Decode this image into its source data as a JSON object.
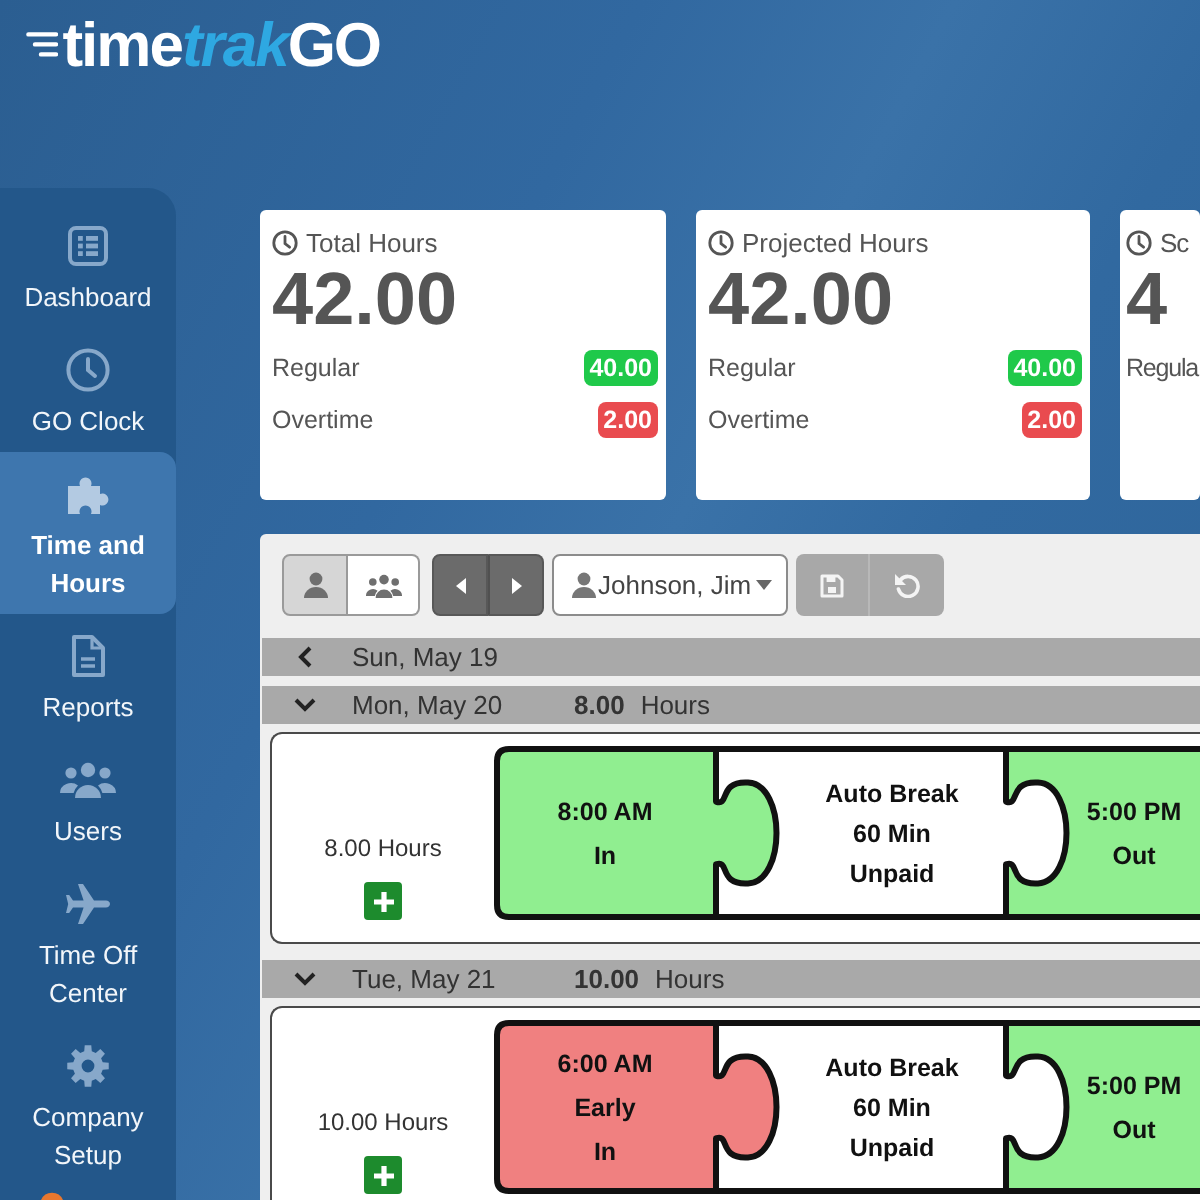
{
  "logo": [
    {
      "text": "time",
      "kind": "plain"
    },
    {
      "text": "trak",
      "kind": "accent"
    },
    {
      "text": "GO",
      "kind": "plain"
    }
  ],
  "sidebar": {
    "items": [
      {
        "label": "Dashboard",
        "selected": false
      },
      {
        "label": "GO Clock",
        "selected": false
      },
      {
        "label": "Time and Hours",
        "selected": true
      },
      {
        "label": "Reports",
        "selected": false
      },
      {
        "label": "Users",
        "selected": false
      },
      {
        "label": "Time Off Center",
        "selected": false
      },
      {
        "label": "Company Setup",
        "selected": false
      }
    ]
  },
  "summary_cards": [
    {
      "title": "Total Hours",
      "value": "42.00",
      "rows": [
        {
          "label": "Regular",
          "badge": "40.00",
          "color": "#1fc94a"
        },
        {
          "label": "Overtime",
          "badge": "2.00",
          "color": "#e94b4f"
        }
      ]
    },
    {
      "title": "Projected Hours",
      "value": "42.00",
      "rows": [
        {
          "label": "Regular",
          "badge": "40.00",
          "color": "#1fc94a"
        },
        {
          "label": "Overtime",
          "badge": "2.00",
          "color": "#e94b4f"
        }
      ]
    },
    {
      "title": "Sc",
      "value": "4",
      "rows": [
        {
          "label": "Regula"
        }
      ]
    }
  ],
  "toolbar": {
    "view_modes": [
      {
        "kind": "single",
        "selected": true
      },
      {
        "kind": "group",
        "selected": false
      }
    ],
    "employee_select": {
      "value": "Johnson, Jim"
    },
    "actions": [
      {
        "kind": "save",
        "disabled": true
      },
      {
        "kind": "undo",
        "disabled": true
      }
    ]
  },
  "days": [
    {
      "date": "Sun, May 19",
      "expanded": false
    },
    {
      "date": "Mon, May 20",
      "hours": "8.00",
      "unit": "Hours",
      "expanded": true,
      "total": "8.00 Hours",
      "punches": [
        {
          "kind": "punch",
          "lines": [
            "8:00 AM",
            "In"
          ],
          "color": "#90ee90"
        },
        {
          "kind": "break",
          "lines": [
            "Auto Break",
            "60 Min",
            "Unpaid"
          ],
          "color": "#ffffff"
        },
        {
          "kind": "punch",
          "lines": [
            "5:00 PM",
            "Out"
          ],
          "color": "#90ee90"
        }
      ]
    },
    {
      "date": "Tue, May 21",
      "hours": "10.00",
      "unit": "Hours",
      "expanded": true,
      "total": "10.00 Hours",
      "punches": [
        {
          "kind": "punch",
          "lines": [
            "6:00 AM",
            "Early",
            "In"
          ],
          "color": "#f08080"
        },
        {
          "kind": "break",
          "lines": [
            "Auto Break",
            "60 Min",
            "Unpaid"
          ],
          "color": "#ffffff"
        },
        {
          "kind": "punch",
          "lines": [
            "5:00 PM",
            "Out"
          ],
          "color": "#90ee90"
        }
      ]
    }
  ]
}
